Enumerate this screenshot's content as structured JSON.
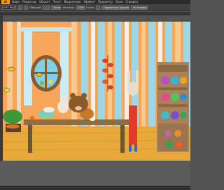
{
  "app": {
    "logo_text": "Ai"
  },
  "menu": {
    "items": [
      "Файл",
      "Редактир",
      "Объект",
      "Текст",
      "Выделение",
      "Эффект",
      "Просмотр",
      "Окно",
      "Справка"
    ]
  },
  "options": {
    "doc_swatch_label": "Без выд.",
    "stroke_label": "Обводка:",
    "stroke_weight": "",
    "brush_label": "Базовая",
    "opacity_label": "Непрозр.",
    "opacity_value": "100%",
    "style_label": "Стиль:",
    "document_setup_label": "Параметры документа",
    "preferences_label": "Установки"
  },
  "status": {
    "zoom": "",
    "tool": ""
  },
  "colors": {
    "chrome_dark": "#2b2b2b",
    "chrome_mid": "#424242",
    "pasteboard": "#5a5a5a",
    "wall_orange": "#f6a55a",
    "wall_stripe_blue": "#9fd6e8",
    "floor": "#e8a93a",
    "table": "#8b6f3c",
    "cabinet": "#a9825b"
  },
  "scene": {
    "description_icon": "illustration-canvas"
  }
}
